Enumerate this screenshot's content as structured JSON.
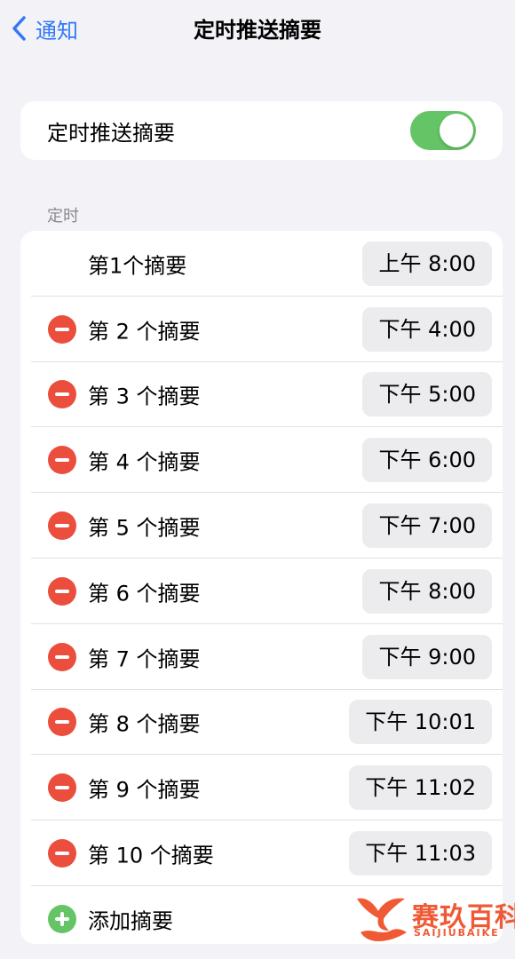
{
  "nav": {
    "back_label": "通知",
    "title": "定时推送摘要"
  },
  "toggle": {
    "label": "定时推送摘要",
    "enabled": true
  },
  "schedule": {
    "header": "定时",
    "items": [
      {
        "label": "第1个摘要",
        "time": "上午 8:00",
        "removable": false
      },
      {
        "label": "第 2 个摘要",
        "time": "下午 4:00",
        "removable": true
      },
      {
        "label": "第 3 个摘要",
        "time": "下午 5:00",
        "removable": true
      },
      {
        "label": "第 4 个摘要",
        "time": "下午 6:00",
        "removable": true
      },
      {
        "label": "第 5 个摘要",
        "time": "下午 7:00",
        "removable": true
      },
      {
        "label": "第 6 个摘要",
        "time": "下午 8:00",
        "removable": true
      },
      {
        "label": "第 7 个摘要",
        "time": "下午 9:00",
        "removable": true
      },
      {
        "label": "第 8 个摘要",
        "time": "下午 10:01",
        "removable": true
      },
      {
        "label": "第 9 个摘要",
        "time": "下午 11:02",
        "removable": true
      },
      {
        "label": "第 10 个摘要",
        "time": "下午 11:03",
        "removable": true
      }
    ],
    "add_label": "添加摘要"
  },
  "watermark": {
    "text": "赛玖百科",
    "subtext": "SAIJIUBAIKE"
  },
  "colors": {
    "accent": "#3478f6",
    "switch_on": "#65c466",
    "remove": "#eb4e3d",
    "add": "#65c466",
    "watermark": "#ef5a35"
  }
}
